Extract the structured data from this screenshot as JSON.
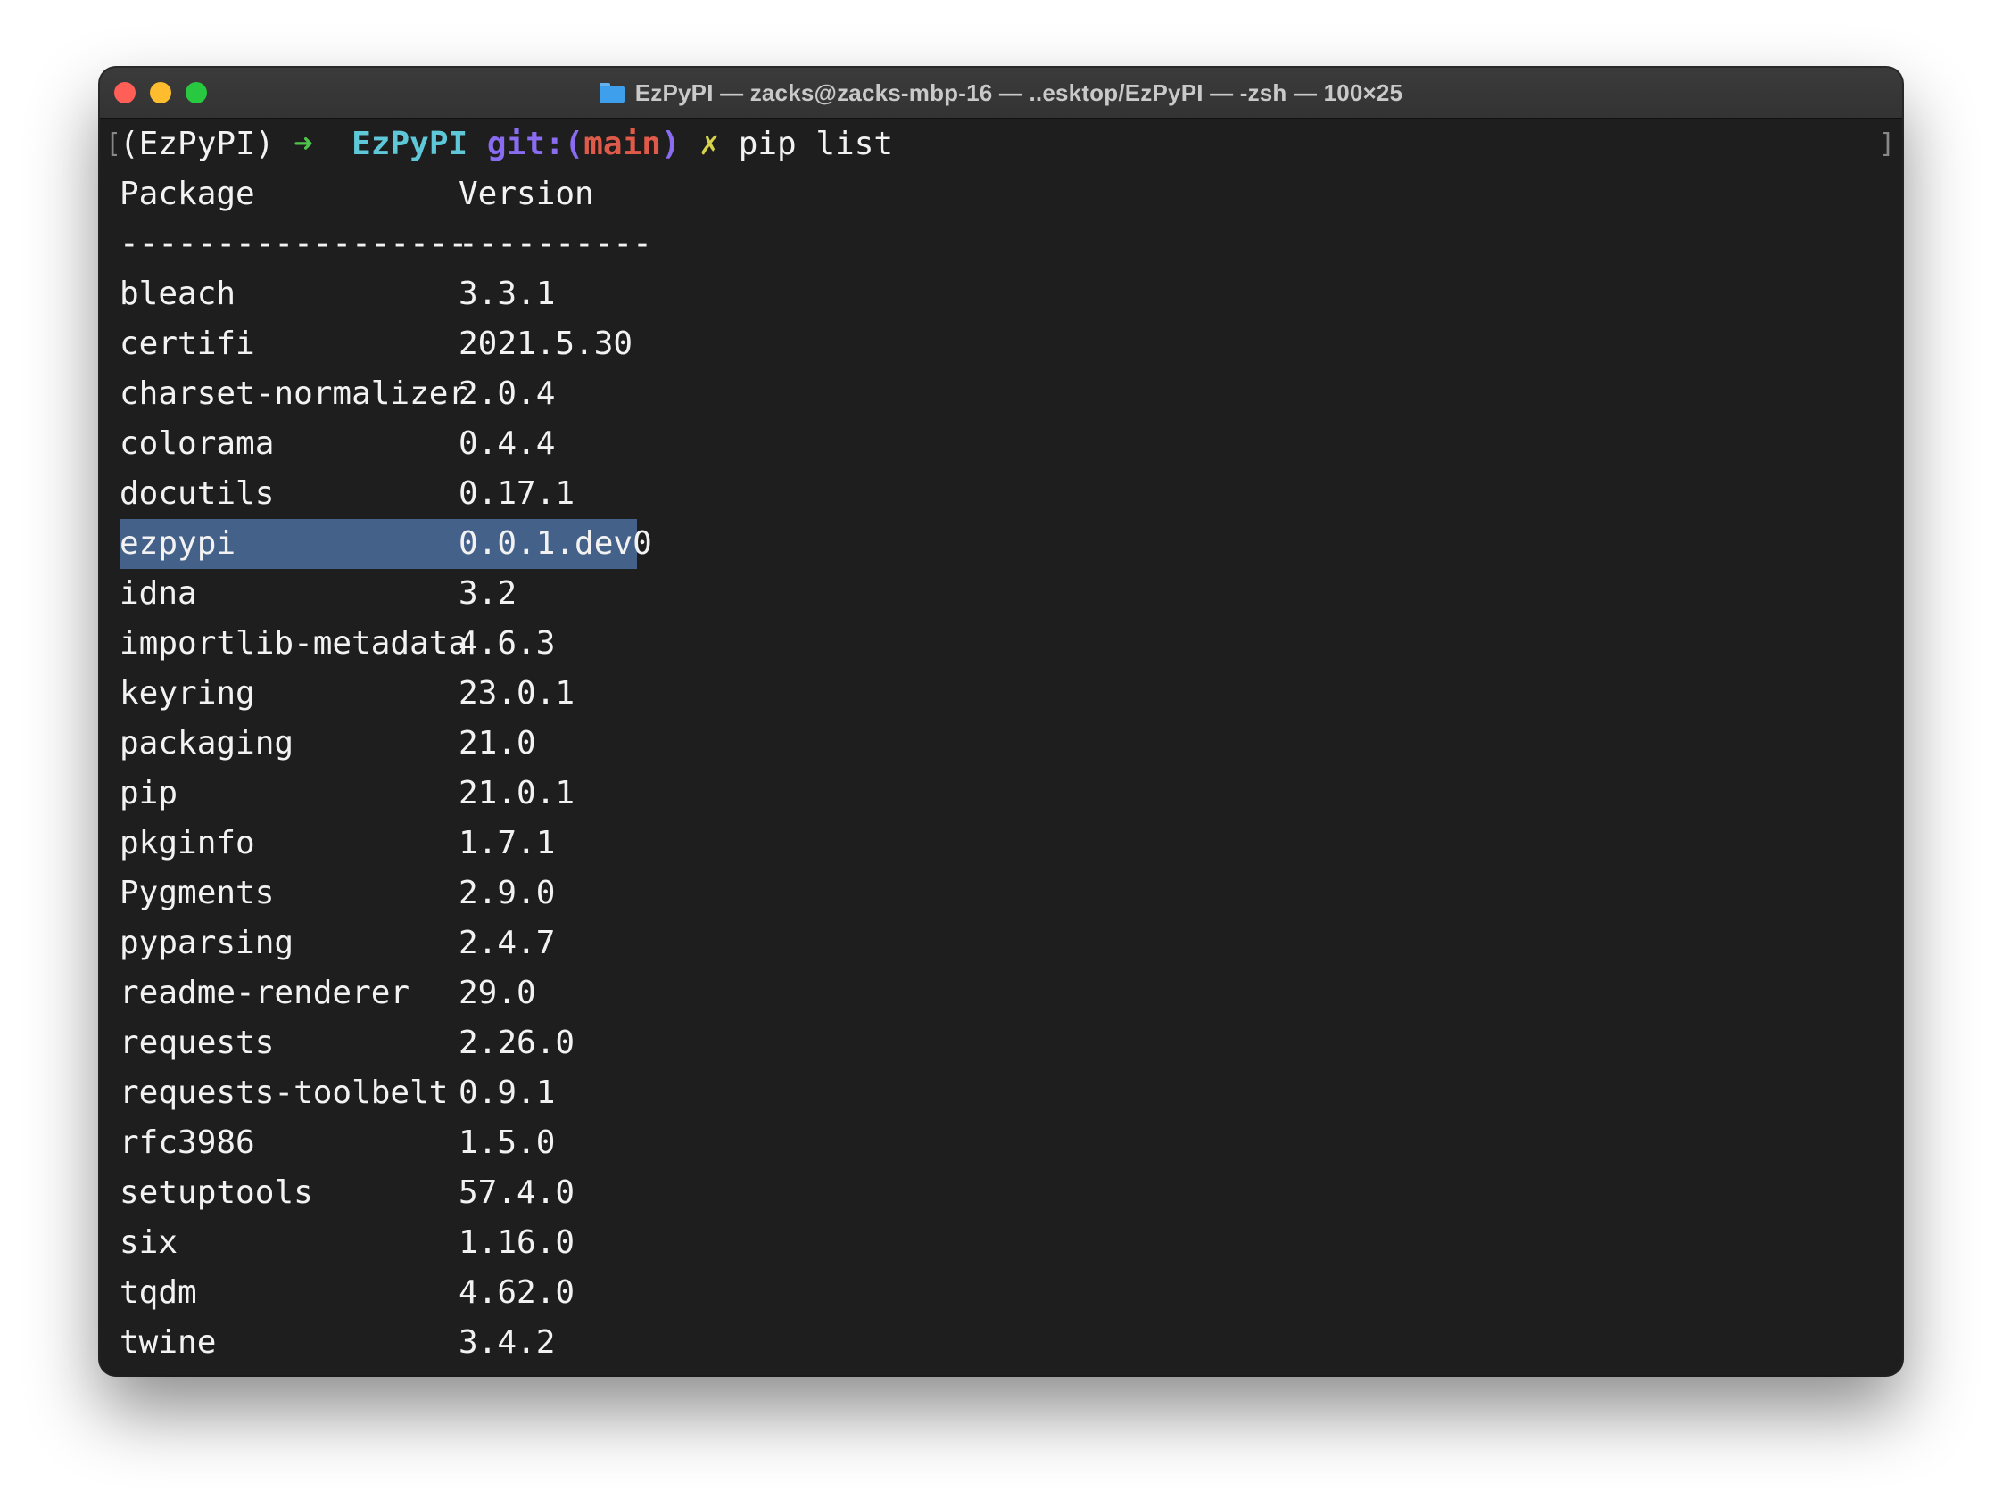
{
  "window": {
    "title": "EzPyPI — zacks@zacks-mbp-16 — ..esktop/EzPyPI — -zsh — 100×25",
    "title_icon": "folder-icon"
  },
  "prompt": {
    "venv": "(EzPyPI)",
    "arrow": "➜",
    "dir": "EzPyPI",
    "git_label": "git:(",
    "branch": "main",
    "git_close": ")",
    "dirty_mark": "✗",
    "command": "pip list"
  },
  "table": {
    "header_package": "Package",
    "header_version": "Version",
    "separator_package": "------------------",
    "separator_version": "----------",
    "rows": [
      {
        "package": "bleach",
        "version": "3.3.1"
      },
      {
        "package": "certifi",
        "version": "2021.5.30"
      },
      {
        "package": "charset-normalizer",
        "version": "2.0.4"
      },
      {
        "package": "colorama",
        "version": "0.4.4"
      },
      {
        "package": "docutils",
        "version": "0.17.1"
      },
      {
        "package": "ezpypi",
        "version": "0.0.1.dev0"
      },
      {
        "package": "idna",
        "version": "3.2"
      },
      {
        "package": "importlib-metadata",
        "version": "4.6.3"
      },
      {
        "package": "keyring",
        "version": "23.0.1"
      },
      {
        "package": "packaging",
        "version": "21.0"
      },
      {
        "package": "pip",
        "version": "21.0.1"
      },
      {
        "package": "pkginfo",
        "version": "1.7.1"
      },
      {
        "package": "Pygments",
        "version": "2.9.0"
      },
      {
        "package": "pyparsing",
        "version": "2.4.7"
      },
      {
        "package": "readme-renderer",
        "version": "29.0"
      },
      {
        "package": "requests",
        "version": "2.26.0"
      },
      {
        "package": "requests-toolbelt",
        "version": "0.9.1"
      },
      {
        "package": "rfc3986",
        "version": "1.5.0"
      },
      {
        "package": "setuptools",
        "version": "57.4.0"
      },
      {
        "package": "six",
        "version": "1.16.0"
      },
      {
        "package": "tqdm",
        "version": "4.62.0"
      },
      {
        "package": "twine",
        "version": "3.4.2"
      }
    ],
    "selected_package": "ezpypi"
  },
  "colors": {
    "terminal_bg": "#1e1e1e",
    "text": "#f2f2f2",
    "selection": "#44618a",
    "arrow": "#4fc44a",
    "dir": "#5fc8d8",
    "git": "#8a6cf0",
    "branch": "#e05a4a",
    "dirty_mark": "#d6d24a"
  }
}
